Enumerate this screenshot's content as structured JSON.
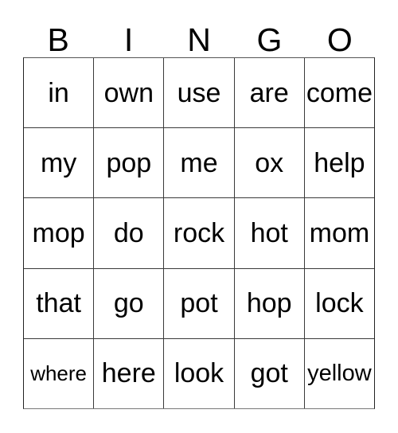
{
  "card": {
    "title": "BINGO",
    "header_letters": [
      "B",
      "I",
      "N",
      "G",
      "O"
    ],
    "rows": 5,
    "columns": 5,
    "grid_background": "#ffffff",
    "border_color": "#3a3a3a",
    "text_color": "#000000",
    "cells": [
      [
        {
          "word": "in",
          "size": "normal"
        },
        {
          "word": "own",
          "size": "normal"
        },
        {
          "word": "use",
          "size": "normal"
        },
        {
          "word": "are",
          "size": "normal"
        },
        {
          "word": "come",
          "size": "normal"
        }
      ],
      [
        {
          "word": "my",
          "size": "normal"
        },
        {
          "word": "pop",
          "size": "normal"
        },
        {
          "word": "me",
          "size": "normal"
        },
        {
          "word": "ox",
          "size": "normal"
        },
        {
          "word": "help",
          "size": "normal"
        }
      ],
      [
        {
          "word": "mop",
          "size": "normal"
        },
        {
          "word": "do",
          "size": "normal"
        },
        {
          "word": "rock",
          "size": "normal"
        },
        {
          "word": "hot",
          "size": "normal"
        },
        {
          "word": "mom",
          "size": "normal"
        }
      ],
      [
        {
          "word": "that",
          "size": "normal"
        },
        {
          "word": "go",
          "size": "normal"
        },
        {
          "word": "pot",
          "size": "normal"
        },
        {
          "word": "hop",
          "size": "normal"
        },
        {
          "word": "lock",
          "size": "normal"
        }
      ],
      [
        {
          "word": "where",
          "size": "small"
        },
        {
          "word": "here",
          "size": "normal"
        },
        {
          "word": "look",
          "size": "normal"
        },
        {
          "word": "got",
          "size": "normal"
        },
        {
          "word": "yellow",
          "size": "medium"
        }
      ]
    ]
  }
}
